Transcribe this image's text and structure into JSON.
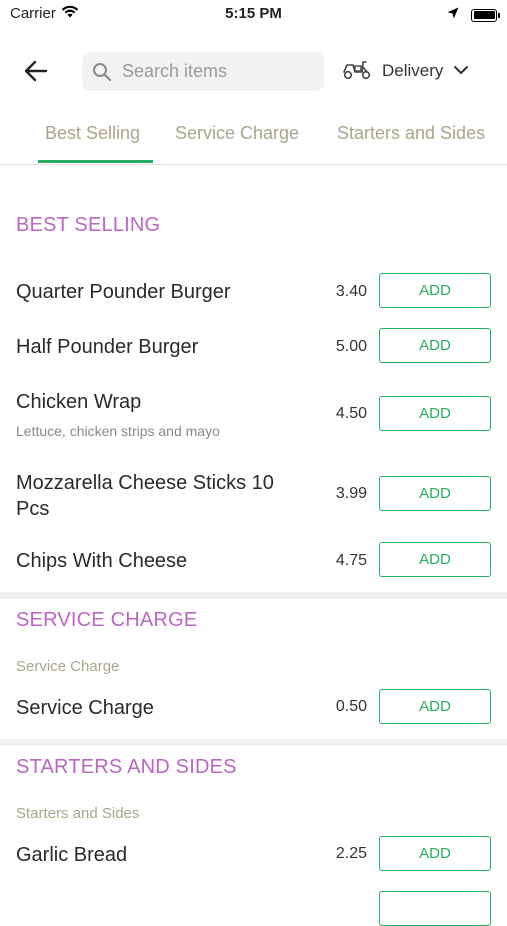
{
  "status_bar": {
    "carrier": "Carrier",
    "time": "5:15 PM"
  },
  "header": {
    "search": {
      "placeholder": "Search items",
      "value": ""
    },
    "delivery_label": "Delivery"
  },
  "tabs": [
    {
      "label": "Best Selling",
      "active": true
    },
    {
      "label": "Service Charge",
      "active": false
    },
    {
      "label": "Starters and Sides",
      "active": false
    }
  ],
  "colors": {
    "accent": "#27ae60",
    "section_title": "#bb66c5",
    "muted": "#a9a58c"
  },
  "sections": [
    {
      "title": "BEST SELLING",
      "subtitle": "",
      "items": [
        {
          "name": "Quarter Pounder Burger",
          "description": "",
          "price": "3.40",
          "button": "ADD"
        },
        {
          "name": "Half Pounder Burger",
          "description": "",
          "price": "5.00",
          "button": "ADD"
        },
        {
          "name": "Chicken Wrap",
          "description": "Lettuce, chicken strips and mayo",
          "price": "4.50",
          "button": "ADD"
        },
        {
          "name": "Mozzarella Cheese Sticks 10 Pcs",
          "description": "",
          "price": "3.99",
          "button": "ADD"
        },
        {
          "name": "Chips With Cheese",
          "description": "",
          "price": "4.75",
          "button": "ADD"
        }
      ]
    },
    {
      "title": "SERVICE CHARGE",
      "subtitle": "Service Charge",
      "items": [
        {
          "name": "Service Charge",
          "description": "",
          "price": "0.50",
          "button": "ADD"
        }
      ]
    },
    {
      "title": "STARTERS AND SIDES",
      "subtitle": "Starters and Sides",
      "items": [
        {
          "name": "Garlic Bread",
          "description": "",
          "price": "2.25",
          "button": "ADD"
        },
        {
          "name": "",
          "description": "",
          "price": "",
          "button": ""
        }
      ]
    }
  ]
}
